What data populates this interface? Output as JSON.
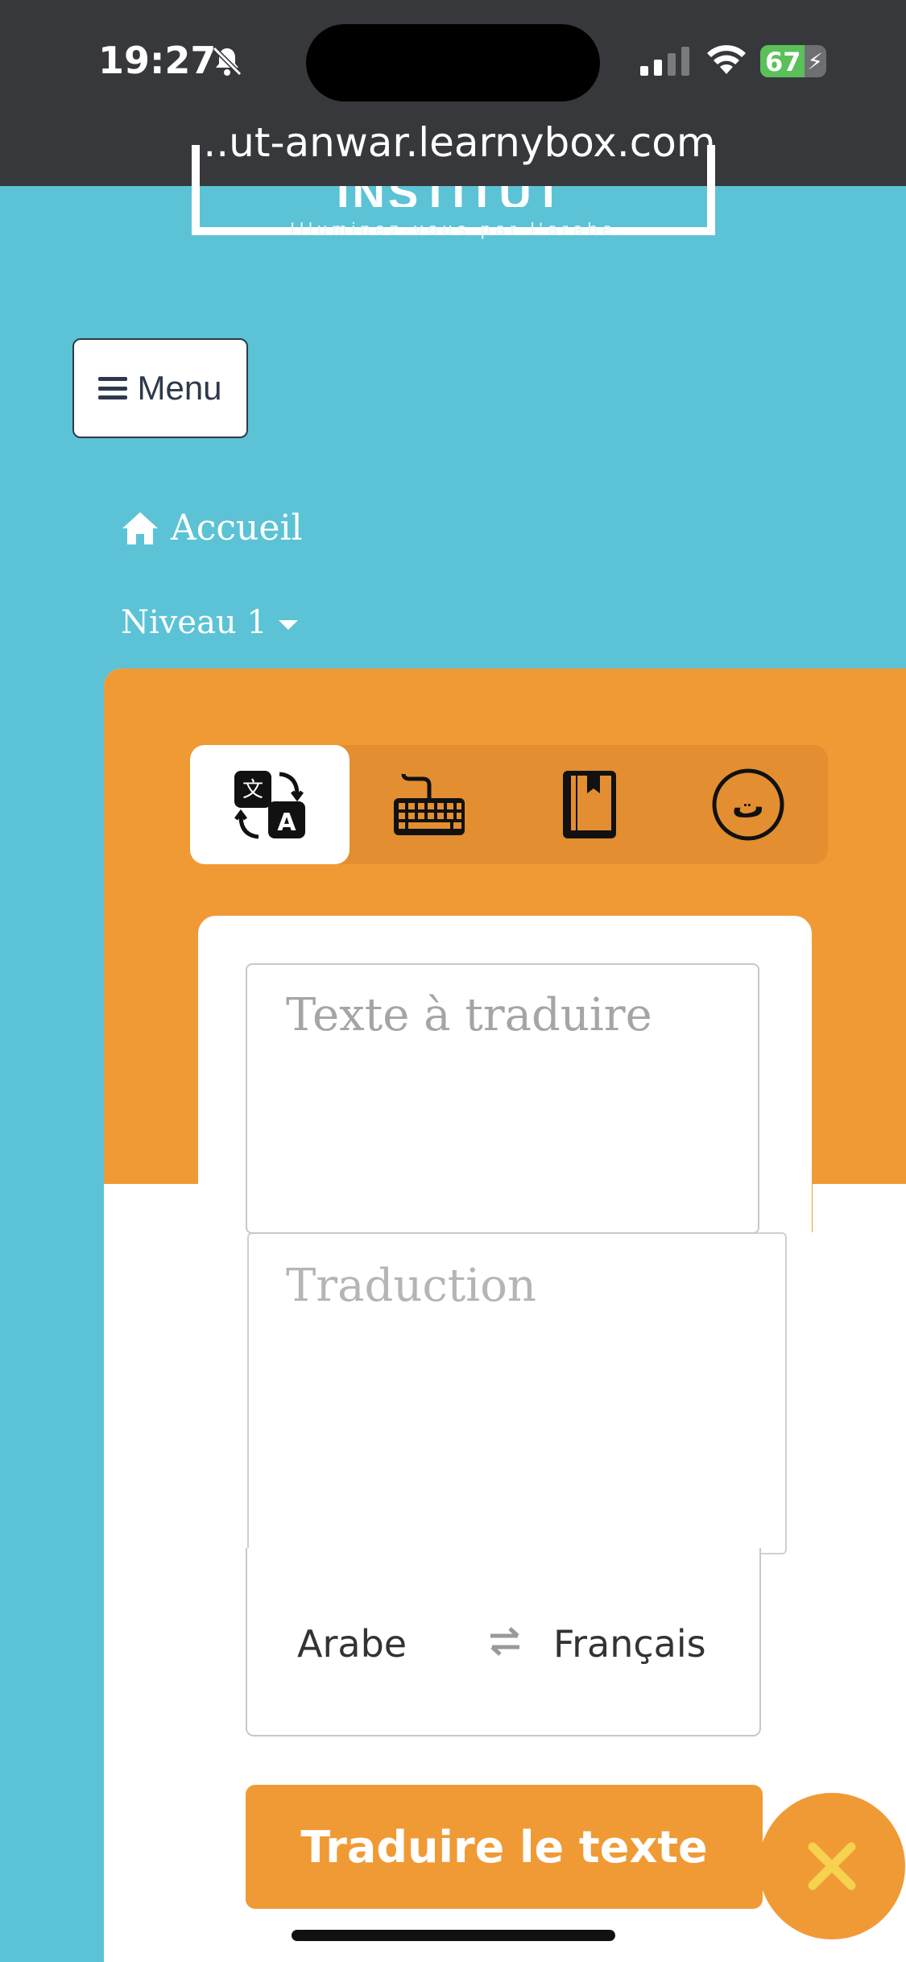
{
  "status_bar": {
    "time": "19:27",
    "battery_level": "67",
    "bell_muted": true
  },
  "browser": {
    "url": "...ut-anwar.learnybox.com"
  },
  "logo": {
    "title": "INSTITUT ANWAR",
    "subtitle": "Illuminez-vous par l'arabe"
  },
  "nav": {
    "menu_label": "Menu",
    "breadcrumb_home": "Accueil",
    "level_label": "Niveau 1"
  },
  "translator": {
    "tabs": [
      {
        "icon": "translate-icon",
        "active": true
      },
      {
        "icon": "keyboard-icon",
        "active": false
      },
      {
        "icon": "book-icon",
        "active": false
      },
      {
        "icon": "arabic-letter-icon",
        "active": false
      }
    ],
    "arabic_letter": "ت",
    "input_placeholder": "Texte à traduire",
    "output_placeholder": "Traduction",
    "source_language": "Arabe",
    "target_language": "Français",
    "translate_button": "Traduire le texte"
  },
  "colors": {
    "background": "#5BC3D5",
    "accent": "#F09A35",
    "status_bar": "#37383B"
  }
}
